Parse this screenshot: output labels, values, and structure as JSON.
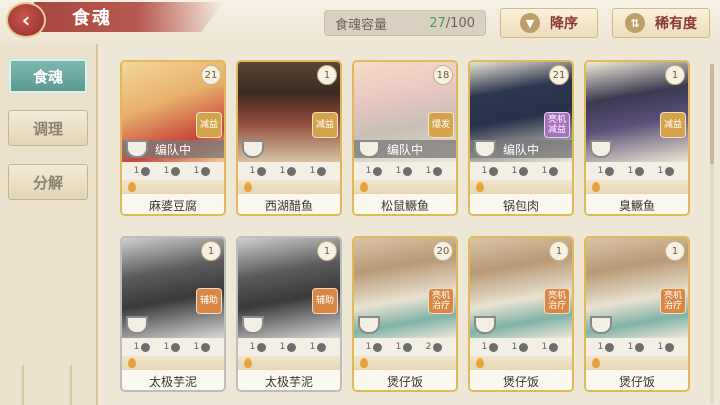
{
  "header": {
    "title": "食魂",
    "capacity_label": "食魂容量",
    "capacity_current": "27",
    "capacity_max": "/100",
    "sort_order_label": "降序",
    "sort_by_label": "稀有度"
  },
  "sidebar": {
    "tabs": [
      {
        "label": "食魂",
        "active": true
      },
      {
        "label": "调理",
        "active": false
      },
      {
        "label": "分解",
        "active": false
      }
    ]
  },
  "cards": [
    {
      "name": "麻婆豆腐",
      "level": "21",
      "badge": "减益",
      "team": "编队中",
      "stats": [
        "1",
        "1",
        "1"
      ],
      "rarity": "gold"
    },
    {
      "name": "西湖醋鱼",
      "level": "1",
      "badge": "减益",
      "team": "",
      "stats": [
        "1",
        "1",
        "1"
      ],
      "rarity": "gold"
    },
    {
      "name": "松鼠鳜鱼",
      "level": "18",
      "badge": "爆发",
      "team": "编队中",
      "stats": [
        "1",
        "1",
        "1"
      ],
      "rarity": "gold"
    },
    {
      "name": "锅包肉",
      "level": "21",
      "badge": "亮机\n减益",
      "team": "编队中",
      "stats": [
        "1",
        "1",
        "1"
      ],
      "rarity": "gold"
    },
    {
      "name": "臭鳜鱼",
      "level": "1",
      "badge": "减益",
      "team": "",
      "stats": [
        "1",
        "1",
        "1"
      ],
      "rarity": "gold"
    },
    {
      "name": "太极芋泥",
      "level": "1",
      "badge": "辅助",
      "team": "",
      "stats": [
        "1",
        "1",
        "1"
      ],
      "rarity": "silver"
    },
    {
      "name": "太极芋泥",
      "level": "1",
      "badge": "辅助",
      "team": "",
      "stats": [
        "1",
        "1",
        "1"
      ],
      "rarity": "silver"
    },
    {
      "name": "煲仔饭",
      "level": "20",
      "badge": "亮机\n治疗",
      "team": "",
      "stats": [
        "1",
        "1",
        "2"
      ],
      "rarity": "gold"
    },
    {
      "name": "煲仔饭",
      "level": "1",
      "badge": "亮机\n治疗",
      "team": "",
      "stats": [
        "1",
        "1",
        "1"
      ],
      "rarity": "gold"
    },
    {
      "name": "煲仔饭",
      "level": "1",
      "badge": "亮机\n治疗",
      "team": "",
      "stats": [
        "1",
        "1",
        "1"
      ],
      "rarity": "gold"
    }
  ]
}
